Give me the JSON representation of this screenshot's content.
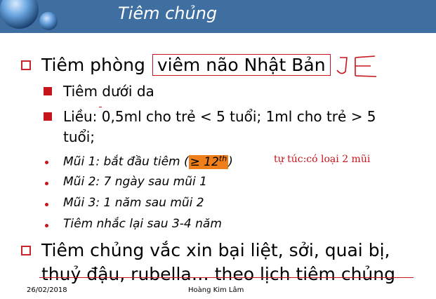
{
  "header": {
    "title": "Tiêm chủng",
    "background_color": "#3f6ea0"
  },
  "accent_color": "#c8151b",
  "highlight_color": "#ef7f1a",
  "bullets": {
    "b1": {
      "prefix": "Tiêm phòng ",
      "boxed": "viêm não Nhật Bản"
    },
    "annotation_je": "JE",
    "sub1": "Tiêm dưới da",
    "sub2_line1": "Liều: 0,5ml cho trẻ < 5 tuổi; 1ml cho trẻ > 5",
    "sub2_line2": "tuổi;",
    "item1": {
      "prefix": "Mũi 1: bắt đầu tiêm (",
      "highlight": "≥ 12",
      "sup": "th",
      "suffix": ")"
    },
    "item2": "Mũi 2: 7 ngày sau mũi 1",
    "item3": "Mũi 3: 1 năm sau mũi 2",
    "item4": "Tiêm nhắc lại sau 3-4 năm",
    "b2_line1": "Tiêm chủng vắc xin bại liệt, sởi, quai bị,",
    "b2_line2": "thuỷ đậu, rubella… theo lịch tiêm chủng"
  },
  "note": "tự túc:có loại 2 mũi",
  "footer": {
    "date": "26/02/2018",
    "author": "Hoàng Kim Lâm"
  }
}
